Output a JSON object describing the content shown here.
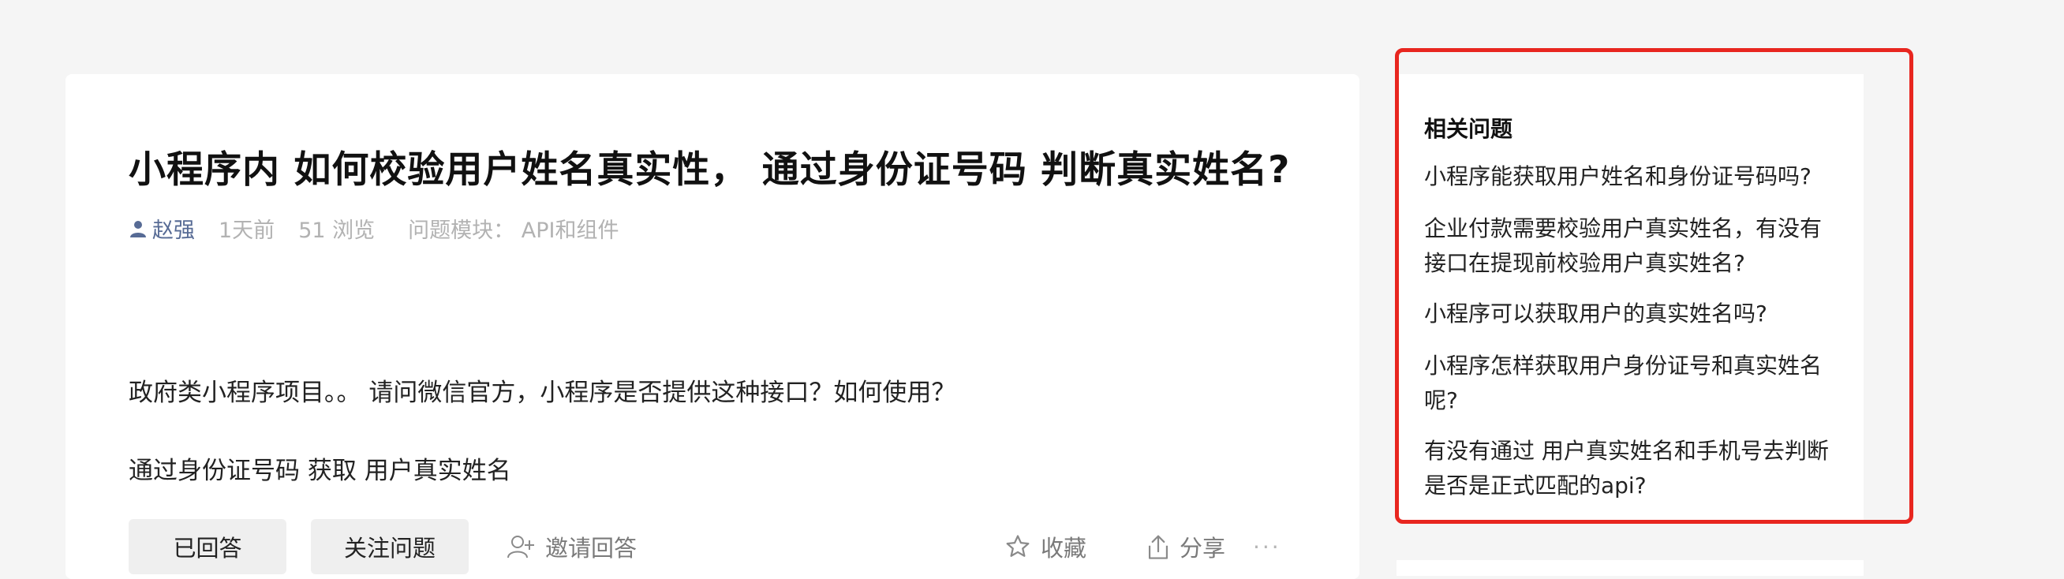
{
  "question": {
    "title": "小程序内 如何校验用户姓名真实性， 通过身份证号码 判断真实姓名?",
    "author": "赵强",
    "time": "1天前",
    "views": "51 浏览",
    "module": "问题模块：  API和组件",
    "body": [
      "政府类小程序项目。。 请问微信官方，小程序是否提供这种接口？如何使用？",
      "通过身份证号码 获取 用户真实姓名"
    ]
  },
  "actions": {
    "answered": "已回答",
    "follow": "关注问题",
    "invite": "邀请回答",
    "collect": "收藏",
    "share": "分享",
    "more": "···"
  },
  "sidebar": {
    "title": "相关问题",
    "items": [
      "小程序能获取用户姓名和身份证号码吗?",
      "企业付款需要校验用户真实姓名，有没有接口在提现前校验用户真实姓名?",
      "小程序可以获取用户的真实姓名吗?",
      "小程序怎样获取用户身份证号和真实姓名呢?",
      "有没有通过 用户真实姓名和手机号去判断是否是正式匹配的api?"
    ]
  },
  "colors": {
    "author_link": "#576b95",
    "highlight_border": "#e8261f"
  }
}
